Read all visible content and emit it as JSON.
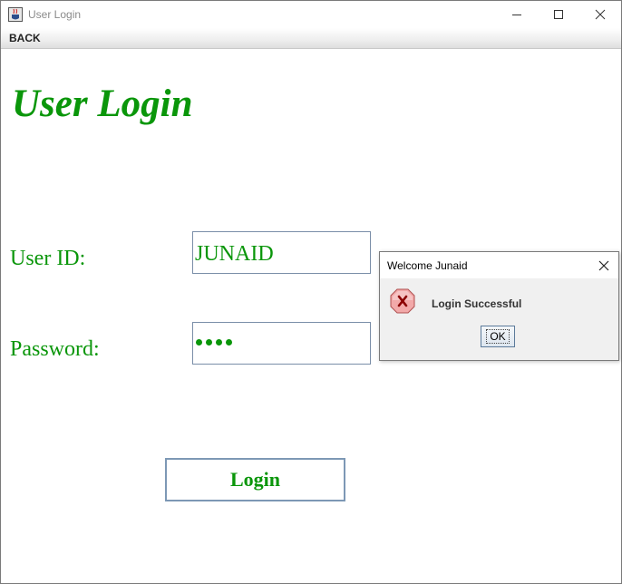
{
  "window": {
    "title": "User Login",
    "icon": "java-cup-icon",
    "controls": {
      "minimize": "minimize-icon",
      "maximize": "maximize-icon",
      "close": "close-icon"
    }
  },
  "menu": {
    "back_label": "BACK"
  },
  "form": {
    "heading": "User Login",
    "user_id_label": "User ID:",
    "user_id_value": "JUNAID",
    "password_label": "Password:",
    "password_masked_length": 4,
    "login_label": "Login"
  },
  "dialog": {
    "title": "Welcome Junaid",
    "message": "Login Successful",
    "icon": "error-icon",
    "ok_label": "OK"
  },
  "colors": {
    "accent_green": "#0a960a",
    "field_border": "#7a8ea8",
    "error_red": "#e07070"
  }
}
